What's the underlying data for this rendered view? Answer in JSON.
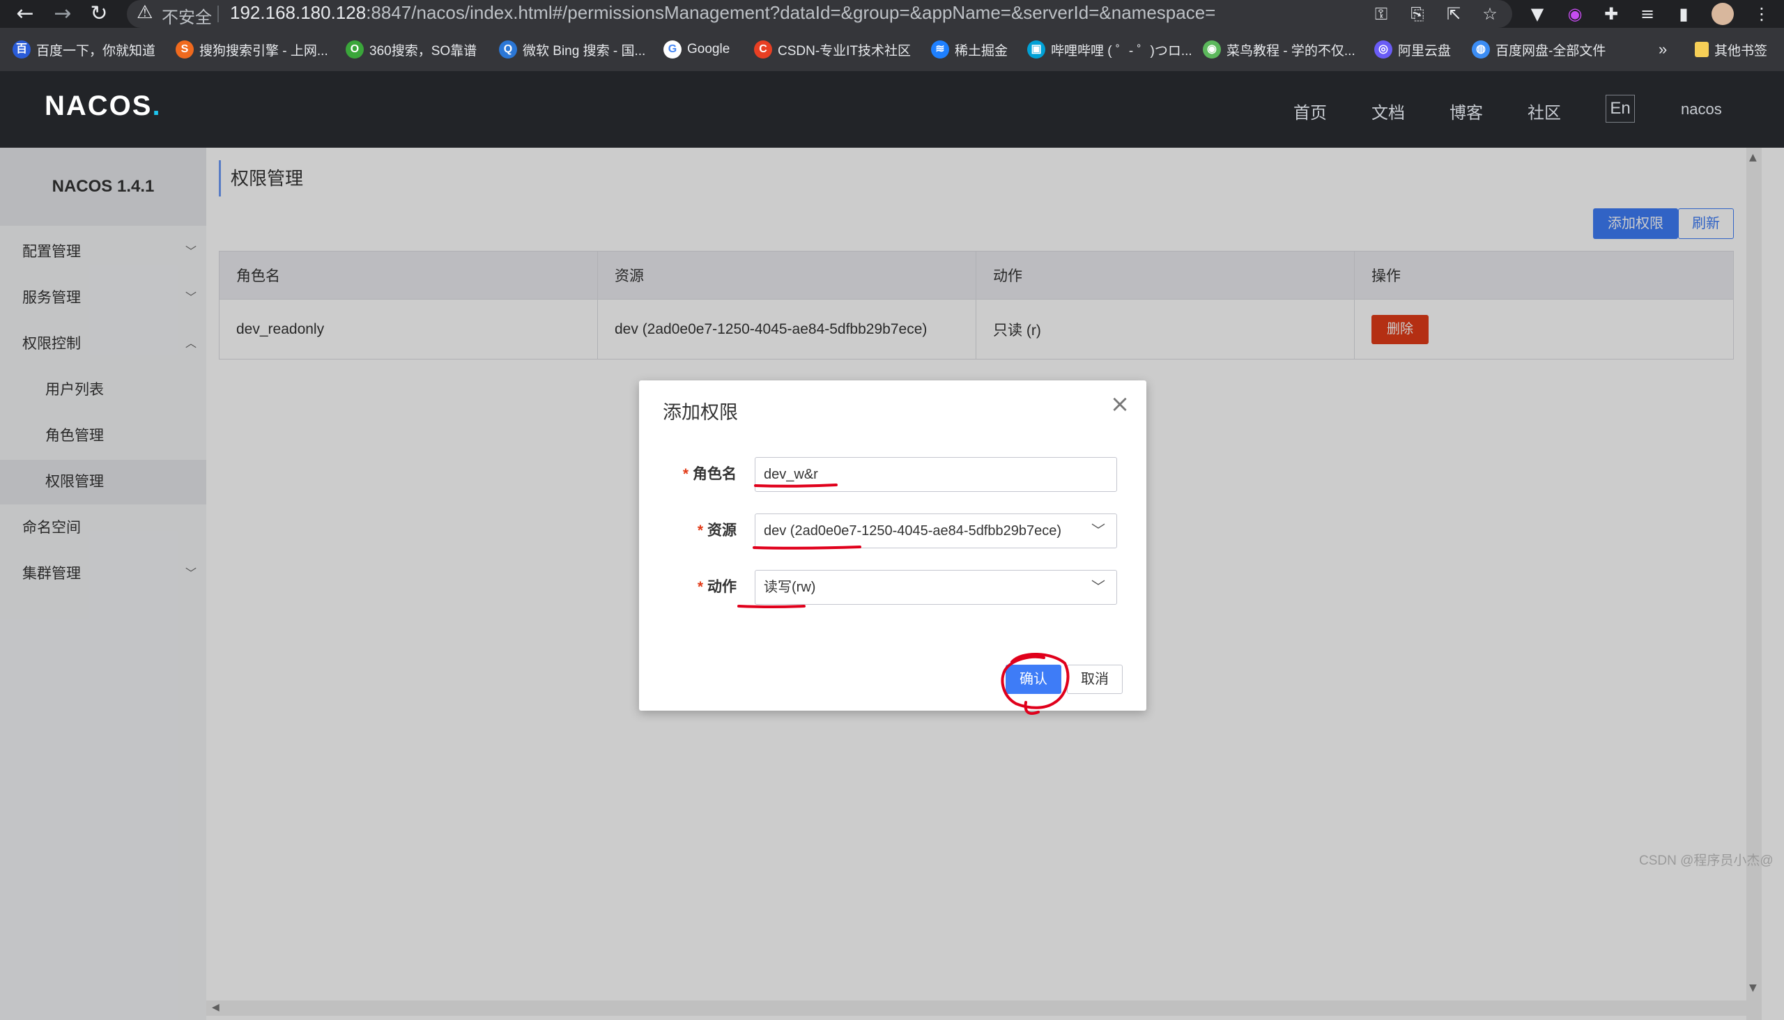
{
  "browser": {
    "nav": {
      "back": "←",
      "forward": "→",
      "reload": "↻"
    },
    "omnibox": {
      "insecure_label": "不安全",
      "url_host": "192.168.180.128",
      "url_rest": ":8847/nacos/index.html#/permissionsManagement?dataId=&group=&appName=&serverId=&namespace="
    },
    "bookmarks": [
      {
        "label": "百度一下，你就知道",
        "icon": "paw-icon",
        "color": "#2a5cd8",
        "glyph": "百"
      },
      {
        "label": "搜狗搜索引擎 - 上网...",
        "icon": "sogou-icon",
        "color": "#f06a1e",
        "glyph": "S"
      },
      {
        "label": "360搜索，SO靠谱",
        "icon": "360-icon",
        "color": "#3aa63a",
        "glyph": "O"
      },
      {
        "label": "微软 Bing 搜索 - 国...",
        "icon": "search-icon",
        "color": "#2b77d6",
        "glyph": "Q"
      },
      {
        "label": "Google",
        "icon": "google-icon",
        "color": "#ffffff",
        "glyph": "G"
      },
      {
        "label": "CSDN-专业IT技术社区",
        "icon": "csdn-icon",
        "color": "#e83f23",
        "glyph": "C"
      },
      {
        "label": "稀土掘金",
        "icon": "juejin-icon",
        "color": "#1e80ff",
        "glyph": "≋"
      },
      {
        "label": "哔哩哔哩 ( ゜- ゜)つロ...",
        "icon": "bilibili-icon",
        "color": "#00a1d6",
        "glyph": "▣"
      },
      {
        "label": "菜鸟教程 - 学的不仅...",
        "icon": "runoob-icon",
        "color": "#5cb85c",
        "glyph": "◉"
      },
      {
        "label": "阿里云盘",
        "icon": "aliyun-drive-icon",
        "color": "#6a5cf6",
        "glyph": "◎"
      },
      {
        "label": "百度网盘-全部文件",
        "icon": "baidu-pan-icon",
        "color": "#3c8df4",
        "glyph": "◍"
      }
    ],
    "bookmarks_more": "»",
    "other_bookmarks": "其他书签"
  },
  "header": {
    "logo_main": "NACOS",
    "logo_dot": ".",
    "nav": [
      "首页",
      "文档",
      "博客",
      "社区"
    ],
    "lang": "En",
    "user": "nacos"
  },
  "sidebar": {
    "title": "NACOS 1.4.1",
    "items": [
      {
        "label": "配置管理",
        "chevron": "﹀"
      },
      {
        "label": "服务管理",
        "chevron": "﹀"
      },
      {
        "label": "权限控制",
        "chevron": "︿"
      },
      {
        "label": "用户列表"
      },
      {
        "label": "角色管理"
      },
      {
        "label": "权限管理"
      },
      {
        "label": "命名空间"
      },
      {
        "label": "集群管理",
        "chevron": "﹀"
      }
    ]
  },
  "main": {
    "title": "权限管理",
    "add_button": "添加权限",
    "refresh_button": "刷新",
    "table": {
      "headers": [
        "角色名",
        "资源",
        "动作",
        "操作"
      ],
      "rows": [
        {
          "role": "dev_readonly",
          "resource": "dev (2ad0e0e7-1250-4045-ae84-5dfbb29b7ece)",
          "action": "只读 (r)",
          "op": "删除"
        }
      ]
    }
  },
  "dialog": {
    "title": "添加权限",
    "close": "×",
    "fields": {
      "role_label": "角色名",
      "role_value": "dev_w&r",
      "resource_label": "资源",
      "resource_value": "dev (2ad0e0e7-1250-4045-ae84-5dfbb29b7ece)",
      "action_label": "动作",
      "action_value": "读写(rw)",
      "required_mark": "*"
    },
    "confirm": "确认",
    "cancel": "取消"
  },
  "watermark": "CSDN @程序员小杰@",
  "colors": {
    "primary": "#3e7cf7",
    "danger": "#e23b18",
    "annotation": "#e0001b"
  }
}
